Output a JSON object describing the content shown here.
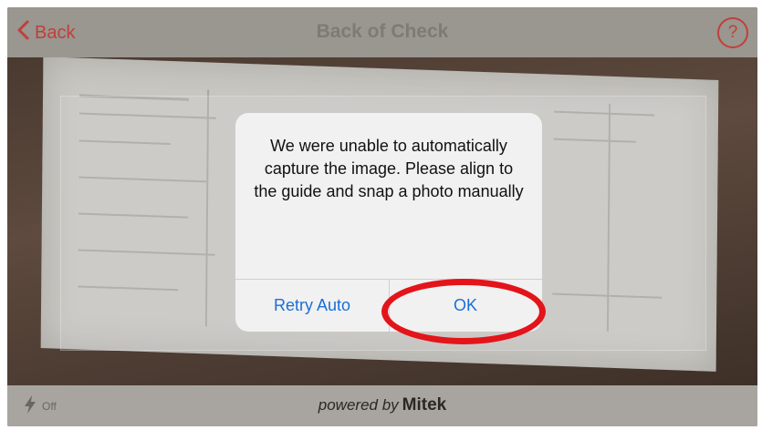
{
  "nav": {
    "back_label": "Back",
    "title": "Back of Check",
    "help_label": "?"
  },
  "dialog": {
    "message": "We were unable to automatically capture the image.  Please align to the guide and snap a photo manually",
    "retry_label": "Retry Auto",
    "ok_label": "OK"
  },
  "bottom": {
    "flash_state": "Off",
    "powered_text": "powered by",
    "brand": "Mitek"
  },
  "colors": {
    "accent": "#c0403a",
    "button_blue": "#1a6fd6",
    "annotation_red": "#e3141a"
  },
  "icons": {
    "back": "chevron-left-icon",
    "help": "question-circle-icon",
    "flash": "lightning-icon"
  }
}
